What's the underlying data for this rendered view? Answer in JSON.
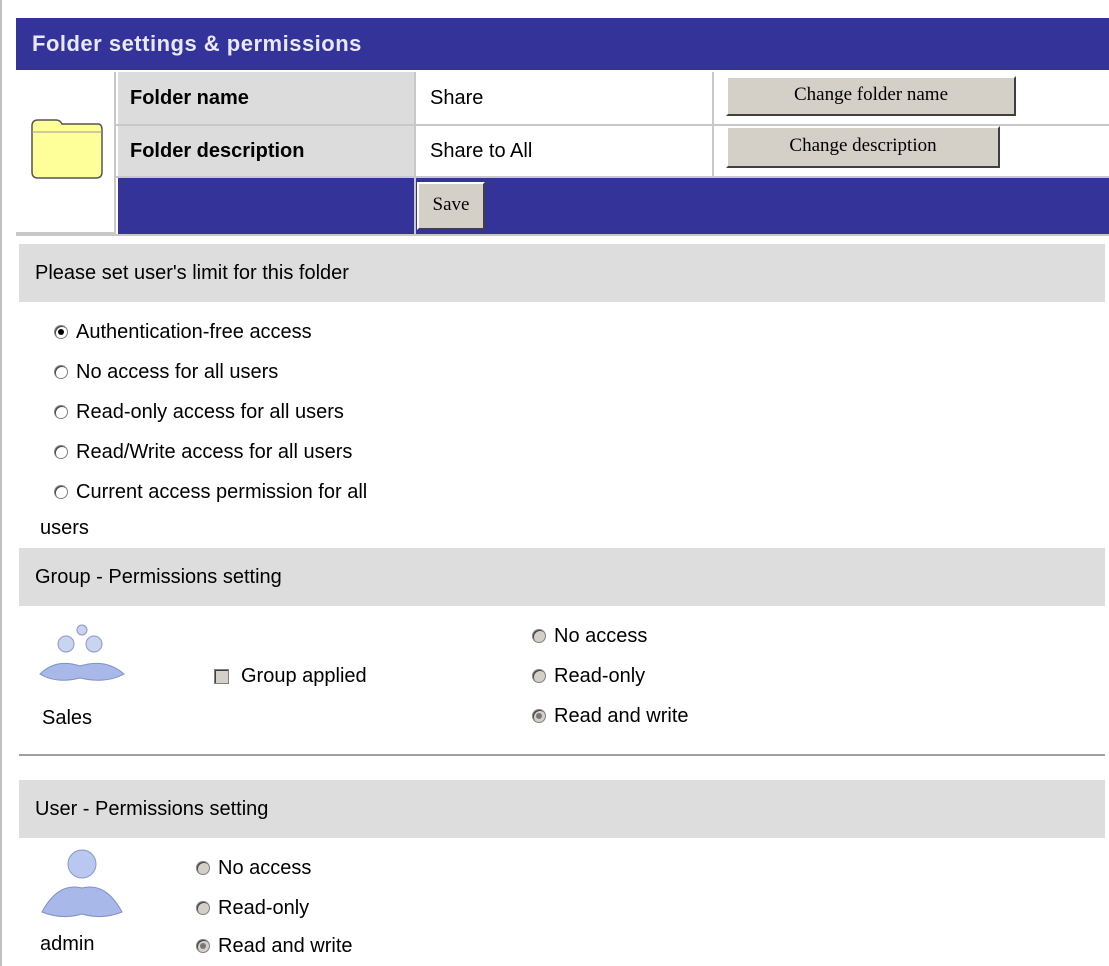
{
  "title": "Folder settings & permissions",
  "folder": {
    "name_label": "Folder name",
    "name_value": "Share",
    "change_name_button": "Change folder name",
    "description_label": "Folder description",
    "description_value": "Share to All",
    "change_description_button": "Change description",
    "save_button": "Save"
  },
  "user_limit": {
    "heading": "Please set user's limit for this folder",
    "options": [
      {
        "label": "Authentication-free access",
        "checked": true
      },
      {
        "label": "No access for all users",
        "checked": false
      },
      {
        "label": "Read-only access for all users",
        "checked": false
      },
      {
        "label": "Read/Write access for all users",
        "checked": false
      },
      {
        "label": "Current access permission for all",
        "label_cont": "users",
        "checked": false
      }
    ]
  },
  "group_permissions": {
    "heading": "Group - Permissions setting",
    "group_name": "Sales",
    "group_applied_label": "Group applied",
    "options": [
      {
        "label": "No access",
        "checked": false
      },
      {
        "label": "Read-only",
        "checked": false
      },
      {
        "label": "Read and write",
        "checked": true
      }
    ]
  },
  "user_permissions": {
    "heading": "User - Permissions setting",
    "user_name": "admin",
    "options": [
      {
        "label": "No access",
        "checked": false
      },
      {
        "label": "Read-only",
        "checked": false
      },
      {
        "label": "Read and write",
        "checked": true
      }
    ]
  },
  "colors": {
    "header_blue": "#343399",
    "section_gray": "#dddddd",
    "folder_yellow": "#ffff99"
  },
  "icons": [
    "folder-icon",
    "group-icon",
    "user-icon"
  ]
}
